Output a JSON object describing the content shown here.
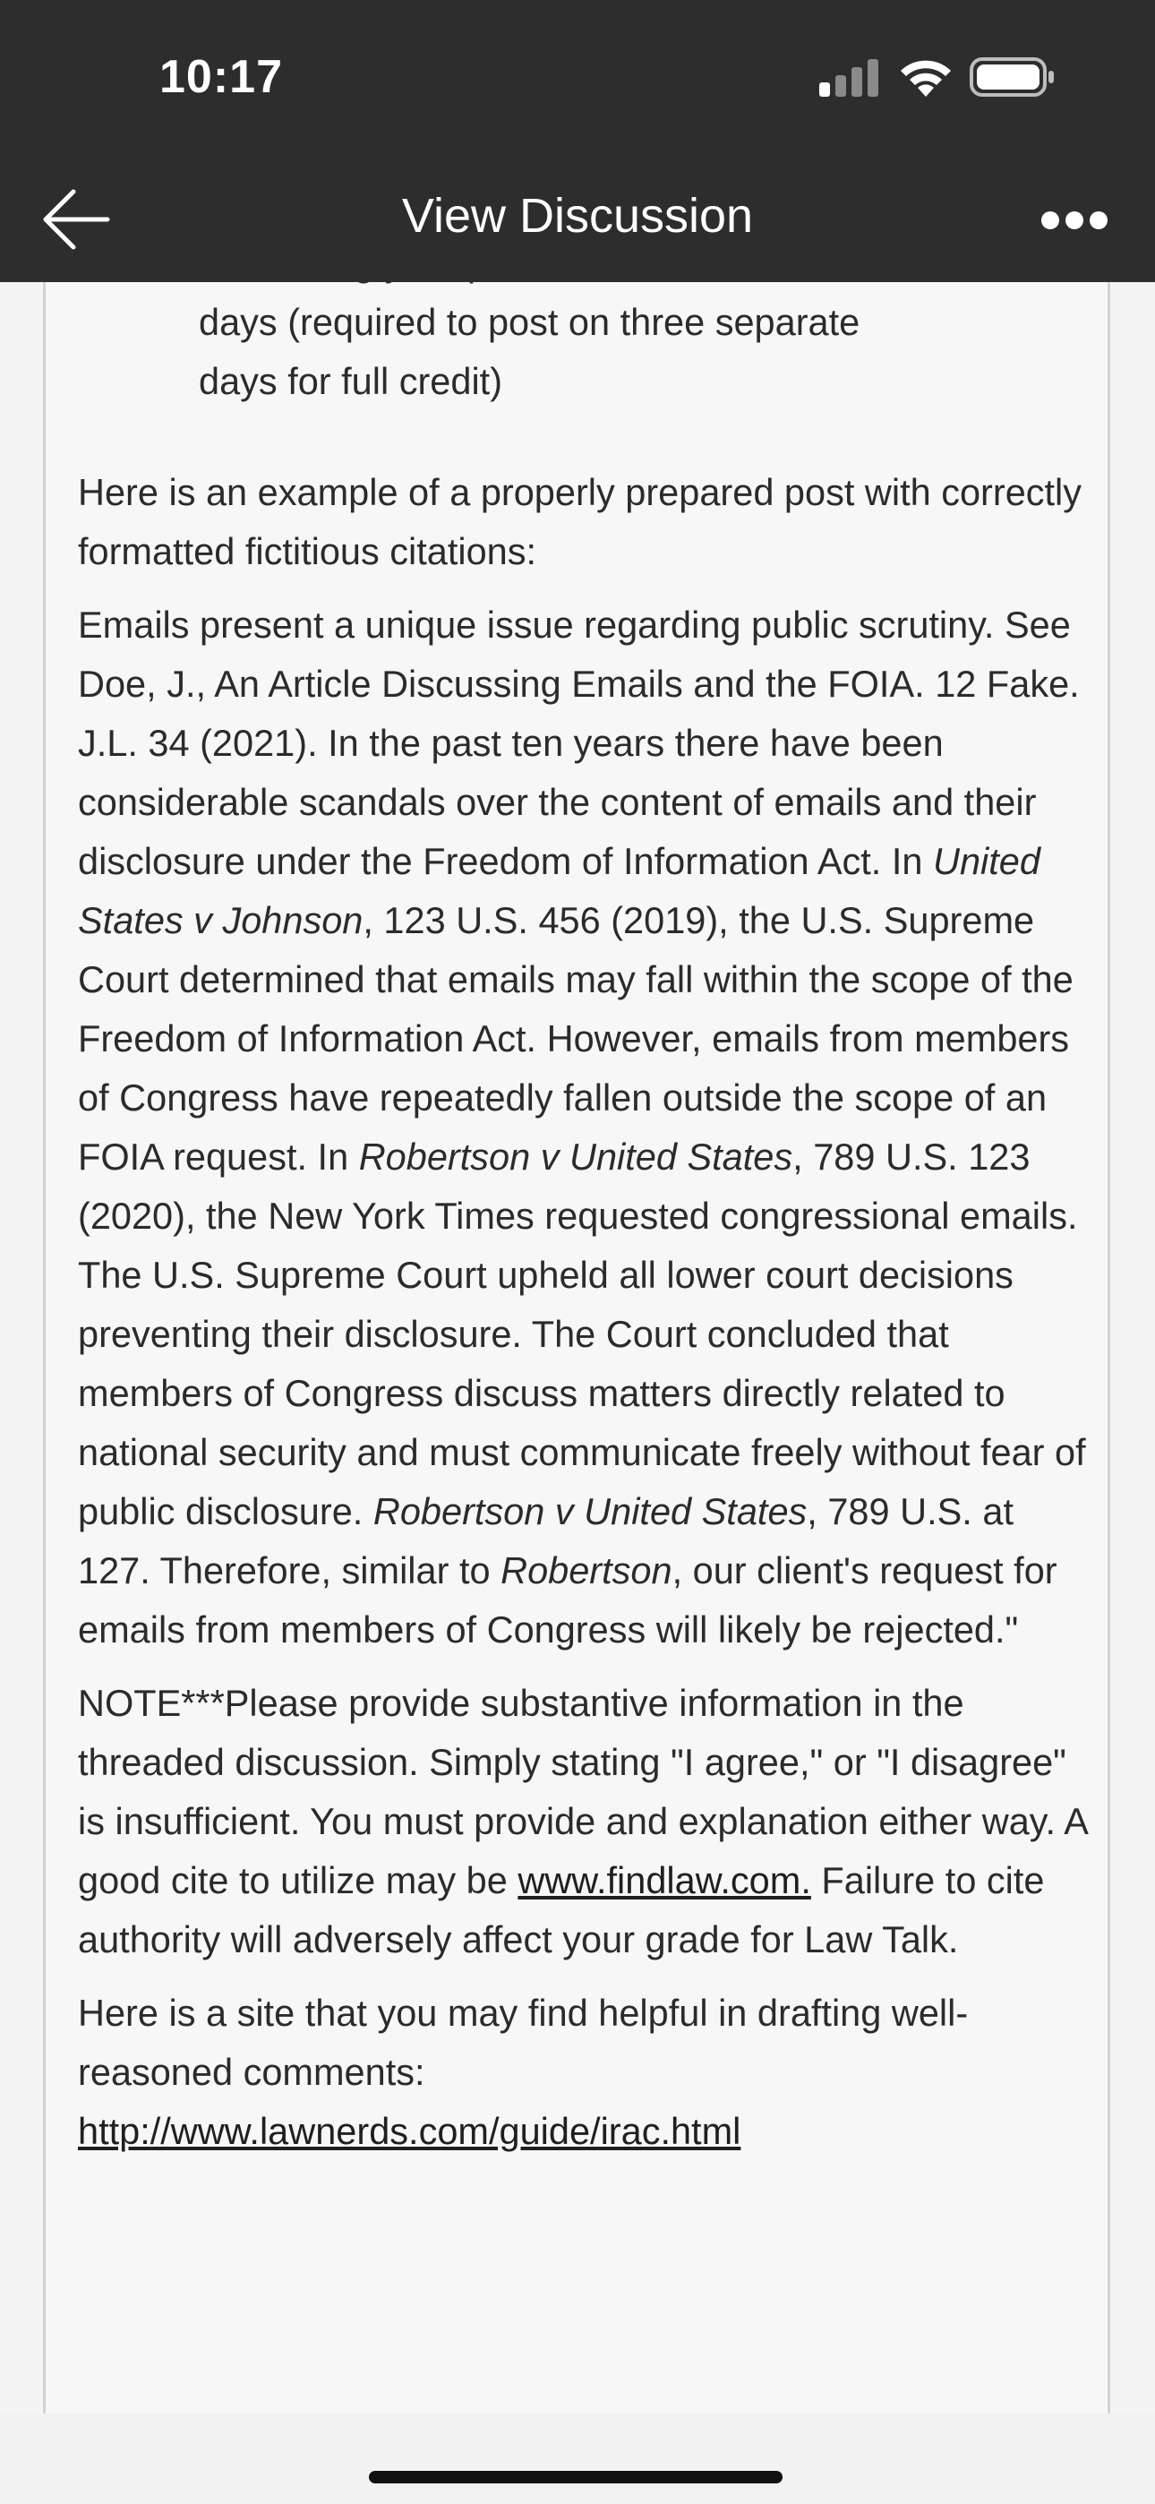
{
  "status_bar": {
    "time": "10:17"
  },
  "header": {
    "title": "View Discussion"
  },
  "post": {
    "bullet_lines": [
      "Submitting your posts on three different",
      "days (required to post on three separate",
      "days for full credit)"
    ],
    "example_intro": "Here is an example of a properly prepared post with correctly formatted fictitious citations:",
    "example": {
      "t1": "Emails present a unique issue regarding public scrutiny. See Doe, J., An Article Discussing Emails and the FOIA. 12 Fake. J.L. 34 (2021). In the past ten years there have been considerable scandals over the content of emails and their disclosure under the Freedom of Information Act. In ",
      "case1": "United States v Johnson",
      "t2": ", 123 U.S. 456 (2019), the U.S. Supreme Court determined that emails may fall within the scope of the Freedom of Information Act. However, emails from members of Congress have repeatedly fallen outside the scope of an FOIA request. In ",
      "case2": "Robertson v United States",
      "t3": ", 789 U.S. 123 (2020), the New York Times requested congressional emails. The U.S. Supreme Court upheld all lower court decisions preventing their disclosure. The Court concluded that members of Congress discuss matters directly related to national security and must communicate freely without fear of public disclosure. ",
      "case3": "Robertson v United States",
      "t4": ", 789 U.S. at 127. Therefore, similar to ",
      "case4": "Robertson",
      "t5": ", our client's request for emails from members of Congress will likely be rejected.\""
    },
    "note": {
      "text_before_link": "NOTE***Please provide substantive information in the threaded discussion. Simply stating \"I agree,\" or \"I disagree\" is insufficient. You must provide and explanation either way. A good cite to utilize may be ",
      "link": "www.findlaw.com.",
      "text_after_link": " Failure to cite authority will adversely affect your grade for Law Talk."
    },
    "helpful": {
      "text": "Here is a site that you may find helpful in drafting well-reasoned comments: ",
      "link": "http://www.lawnerds.com/guide/irac.html"
    }
  }
}
